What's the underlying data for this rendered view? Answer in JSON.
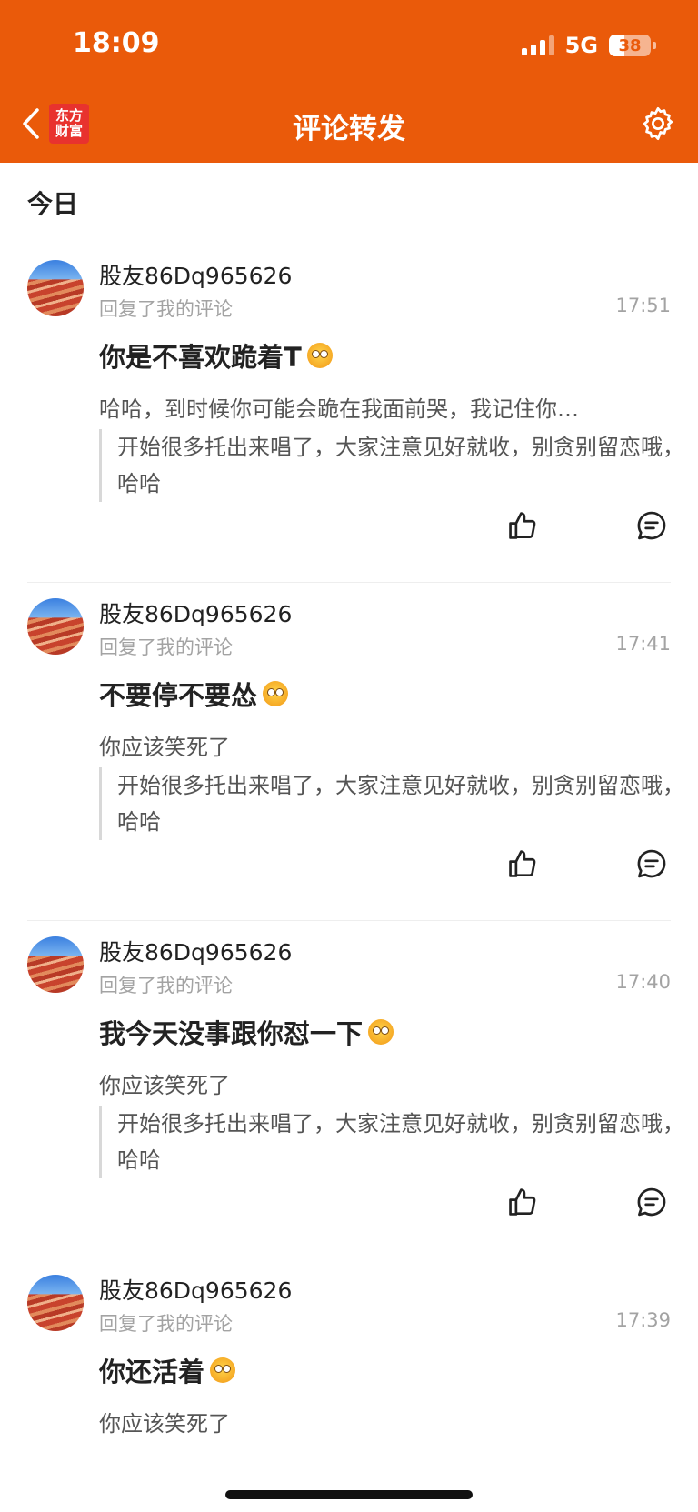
{
  "status": {
    "time": "18:09",
    "network": "5G",
    "battery": "38"
  },
  "nav": {
    "logo_line1": "东方",
    "logo_line2": "财富",
    "title": "评论转发"
  },
  "section": {
    "title": "今日"
  },
  "items": [
    {
      "username": "股友86Dq965626",
      "subtitle": "回复了我的评论",
      "time": "17:51",
      "comment": "你是不喜欢跪着T",
      "reply": "哈哈，到时候你可能会跪在我面前哭，我记住你…",
      "quote": "开始很多托出来唱了，大家注意见好就收，别贪别留恋哦，哈哈"
    },
    {
      "username": "股友86Dq965626",
      "subtitle": "回复了我的评论",
      "time": "17:41",
      "comment": "不要停不要怂",
      "reply": "你应该笑死了",
      "quote": "开始很多托出来唱了，大家注意见好就收，别贪别留恋哦，哈哈"
    },
    {
      "username": "股友86Dq965626",
      "subtitle": "回复了我的评论",
      "time": "17:40",
      "comment": "我今天没事跟你怼一下",
      "reply": "你应该笑死了",
      "quote": "开始很多托出来唱了，大家注意见好就收，别贪别留恋哦，哈哈"
    },
    {
      "username": "股友86Dq965626",
      "subtitle": "回复了我的评论",
      "time": "17:39",
      "comment": "你还活着",
      "reply": "你应该笑死了"
    }
  ],
  "colors": {
    "brand": "#ea5a0a",
    "logo_red": "#e8322e",
    "muted": "#a3a3a3"
  },
  "icons": [
    "back-icon",
    "settings-icon",
    "like-icon",
    "comment-icon"
  ]
}
